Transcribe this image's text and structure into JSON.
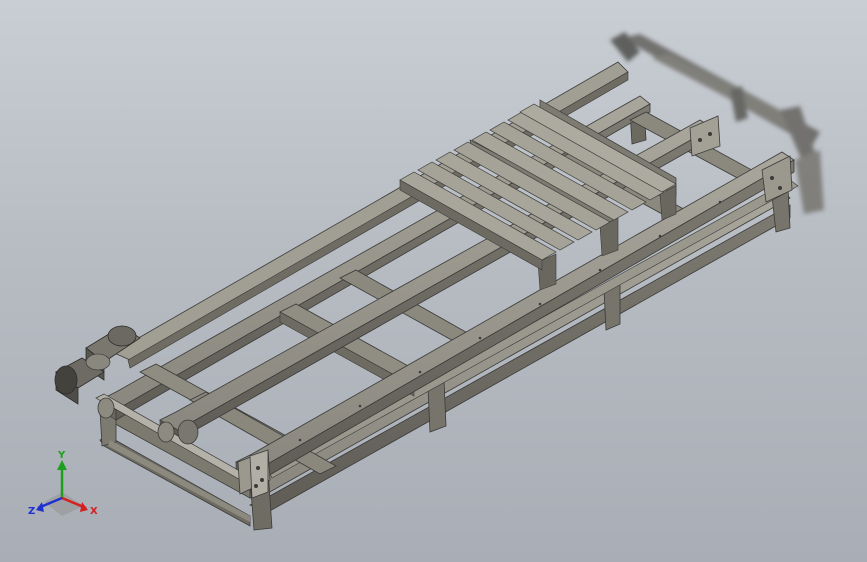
{
  "window": {
    "title": ""
  },
  "viewport": {
    "background": "#b9bec5",
    "part_color": "#8f8c82",
    "edge_color": "#3a3a38"
  },
  "triad": {
    "x_label": "X",
    "y_label": "Y",
    "z_label": "Z",
    "x_color": "#d42020",
    "y_color": "#1ea01e",
    "z_color": "#2030d0"
  }
}
